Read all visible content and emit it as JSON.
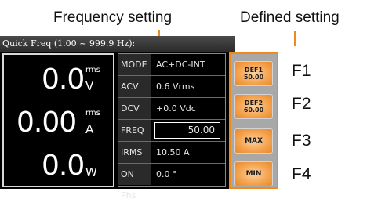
{
  "annotations": {
    "frequency_setting": "Frequency setting",
    "defined_setting": "Defined setting",
    "function_keys": [
      "F1",
      "F2",
      "F3",
      "F4"
    ]
  },
  "screen": {
    "title": "Quick Freq (1.00 ~ 999.9 Hz):",
    "measurements": [
      {
        "value": "0.0",
        "unit": "V",
        "superscript": "rms"
      },
      {
        "value": "0.00",
        "unit": "A",
        "superscript": "rms"
      },
      {
        "value": "0.0",
        "unit": "W",
        "superscript": ""
      }
    ],
    "parameters": [
      {
        "label": "MODE",
        "value": "AC+DC-INT"
      },
      {
        "label": "ACV",
        "value": "0.6 Vrms"
      },
      {
        "label": "DCV",
        "value": "+0.0 Vdc"
      },
      {
        "label": "FREQ",
        "value": "50.00"
      },
      {
        "label": "IRMS",
        "value": "10.50 A"
      },
      {
        "label": "ON Phs",
        "value": "0.0 °"
      }
    ],
    "softkeys": [
      {
        "line1": "DEF1",
        "line2": "50.00"
      },
      {
        "line1": "DEF2",
        "line2": "60.00"
      },
      {
        "line1": "MAX"
      },
      {
        "line1": "MIN"
      }
    ]
  },
  "colors": {
    "accent_orange": "#f08a1c",
    "button_orange": "#f5a552",
    "screen_bg": "#000000"
  }
}
